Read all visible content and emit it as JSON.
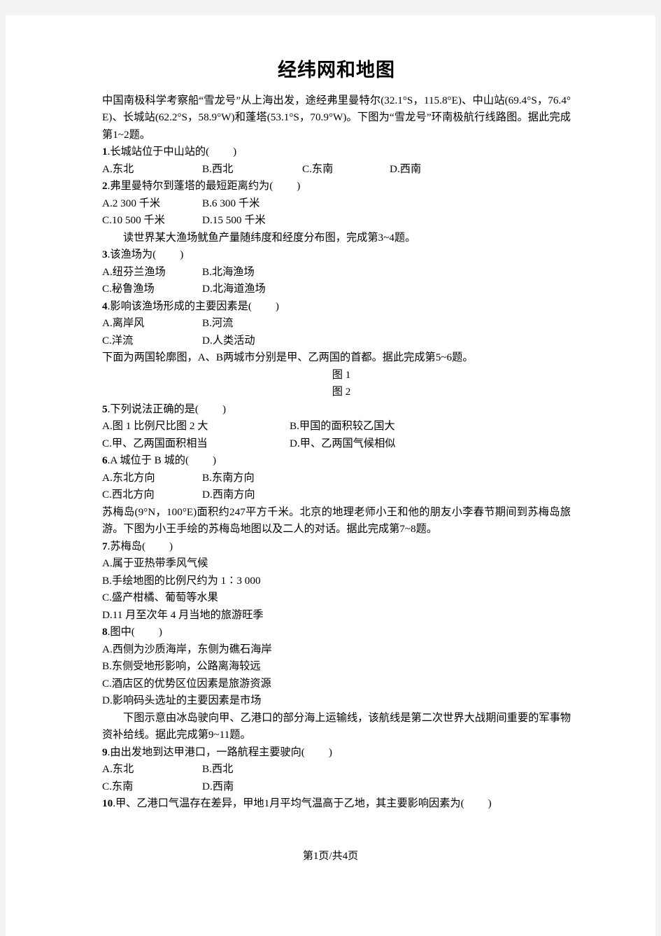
{
  "document": {
    "title": "经纬网和地图",
    "footer": "第1页/共4页"
  },
  "passages": {
    "p1": "中国南极科学考察船“雪龙号”从上海出发，途经弗里曼特尔(32.1°S，115.8°E)、中山站(69.4°S，76.4°E)、长城站(62.2°S，58.9°W)和蓬塔(53.1°S，70.9°W)。下图为“雪龙号”环南极航行线路图。据此完成第1~2题。",
    "p2": "读世界某大渔场鱿鱼产量随纬度和经度分布图，完成第3~4题。",
    "p3": "下面为两国轮廓图，A、B两城市分别是甲、乙两国的首都。据此完成第5~6题。",
    "p4": "苏梅岛(9°N，100°E)面积约247平方千米。北京的地理老师小王和他的朋友小李春节期间到苏梅岛旅游。下图为小王手绘的苏梅岛地图以及二人的对话。据此完成第7~8题。",
    "p5": "下图示意由冰岛驶向甲、乙港口的部分海上运输线，该航线是第二次世界大战期间重要的军事物资补给线。据此完成第9~11题。"
  },
  "figure_labels": {
    "fig1": "图 1",
    "fig2": "图 2"
  },
  "questions": [
    {
      "num": "1",
      "stem": ".长城站位于中山站的(",
      "close": ")",
      "layout": "opts-4",
      "options": [
        "A.东北",
        "B.西北",
        "C.东南",
        "D.西南"
      ]
    },
    {
      "num": "2",
      "stem": ".弗里曼特尔到蓬塔的最短距离约为(",
      "close": ")",
      "layout": "opts-2n",
      "options": [
        "A.2 300 千米",
        "B.6 300 千米",
        "C.10 500 千米",
        "D.15 500 千米"
      ]
    },
    {
      "num": "3",
      "stem": ".该渔场为(",
      "close": ")",
      "layout": "opts-2n",
      "options": [
        "A.纽芬兰渔场",
        "B.北海渔场",
        "C.秘鲁渔场",
        "D.北海道渔场"
      ]
    },
    {
      "num": "4",
      "stem": ".影响该渔场形成的主要因素是(",
      "close": ")",
      "layout": "opts-2n",
      "options": [
        "A.离岸风",
        "B.河流",
        "C.洋流",
        "D.人类活动"
      ]
    },
    {
      "num": "5",
      "stem": ".下列说法正确的是(",
      "close": ")",
      "layout": "opts-2w",
      "options": [
        "A.图 1 比例尺比图 2 大",
        "B.甲国的面积较乙国大",
        "C.甲、乙两国面积相当",
        "D.甲、乙两国气候相似"
      ]
    },
    {
      "num": "6",
      "stem": ".A 城位于 B 城的(",
      "close": ")",
      "layout": "opts-2n",
      "options": [
        "A.东北方向",
        "B.东南方向",
        "C.西北方向",
        "D.西南方向"
      ]
    },
    {
      "num": "7",
      "stem": ".苏梅岛(",
      "close": ")",
      "layout": "opts-1",
      "options": [
        "A.属于亚热带季风气候",
        "B.手绘地图的比例尺约为 1∶3 000",
        "C.盛产柑橘、葡萄等水果",
        "D.11 月至次年 4 月当地的旅游旺季"
      ]
    },
    {
      "num": "8",
      "stem": ".图中(",
      "close": ")",
      "layout": "opts-1",
      "options": [
        "A.西侧为沙质海岸，东侧为礁石海岸",
        "B.东侧受地形影响，公路离海较远",
        "C.酒店区的优势区位因素是旅游资源",
        "D.影响码头选址的主要因素是市场"
      ]
    },
    {
      "num": "9",
      "stem": ".由出发地到达甲港口，一路航程主要驶向(",
      "close": ")",
      "layout": "opts-2n",
      "options": [
        "A.东北",
        "B.西北",
        "C.东南",
        "D.西南"
      ]
    },
    {
      "num": "10",
      "stem": ".甲、乙港口气温存在差异，甲地1月平均气温高于乙地，其主要影响因素为(",
      "close": ")",
      "layout": "none",
      "options": []
    }
  ]
}
